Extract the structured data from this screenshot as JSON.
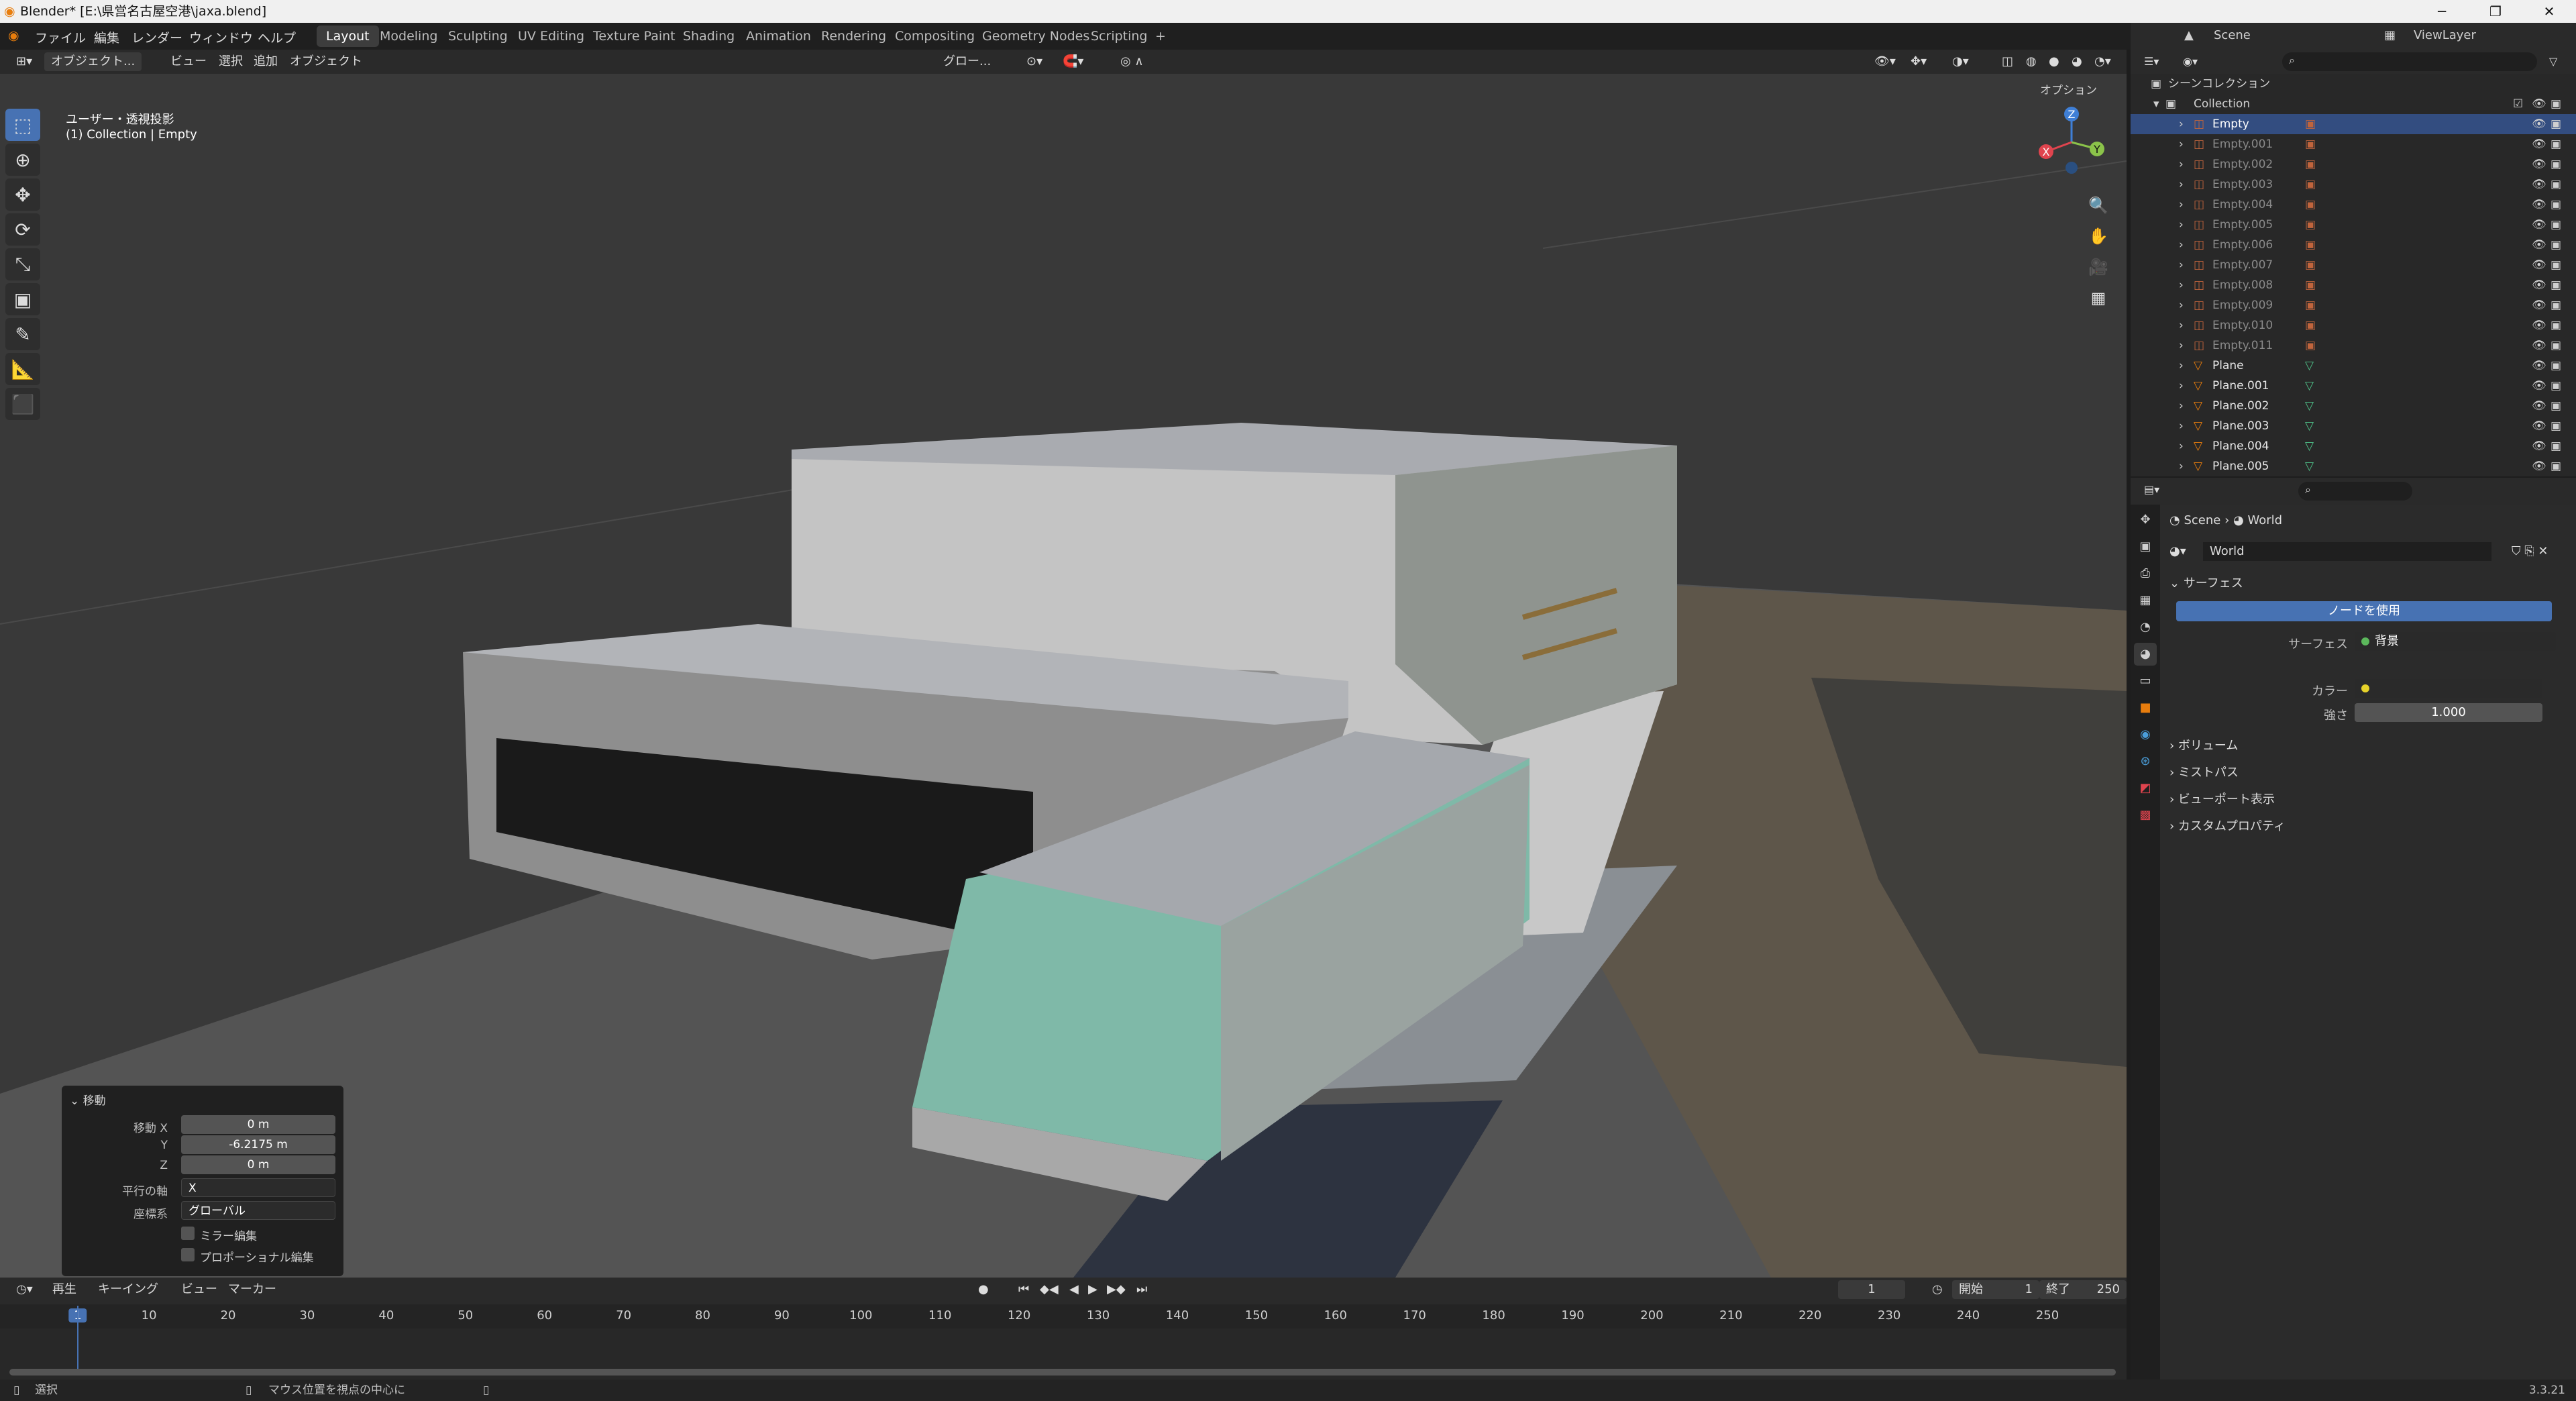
{
  "window": {
    "title": "Blender* [E:\\県営名古屋空港\\jaxa.blend]"
  },
  "menu": [
    "ファイル",
    "編集",
    "レンダー",
    "ウィンドウ",
    "ヘルプ"
  ],
  "workspaces": [
    "Layout",
    "Modeling",
    "Sculpting",
    "UV Editing",
    "Texture Paint",
    "Shading",
    "Animation",
    "Rendering",
    "Compositing",
    "Geometry Nodes",
    "Scripting"
  ],
  "workspace_add": "+",
  "scene": {
    "name": "Scene",
    "viewlayer": "ViewLayer"
  },
  "viewport": {
    "mode": "オブジェクト...",
    "menus": [
      "ビュー",
      "選択",
      "追加",
      "オブジェクト"
    ],
    "transform": "グロー...",
    "options": "オプション",
    "overlay_line1": "ユーザー・透視投影",
    "overlay_line2": "(1) Collection | Empty",
    "gizmo": {
      "x": "X",
      "y": "Y",
      "z": "Z"
    }
  },
  "operator_panel": {
    "title": "移動",
    "fields": [
      {
        "label": "移動 X",
        "value": "0 m"
      },
      {
        "label": "Y",
        "value": "-6.2175 m"
      },
      {
        "label": "Z",
        "value": "0 m"
      }
    ],
    "axis_label": "平行の軸",
    "axis_value": "X",
    "coord_label": "座標系",
    "coord_value": "グローバル",
    "check1": "ミラー編集",
    "check2": "プロポーショナル編集"
  },
  "timeline": {
    "menus": [
      "再生",
      "キーイング",
      "ビュー",
      "マーカー"
    ],
    "current_frame": "1",
    "start_label": "開始",
    "start": "1",
    "end_label": "終了",
    "end": "250",
    "ticks": [
      "1",
      "10",
      "20",
      "30",
      "40",
      "50",
      "60",
      "70",
      "80",
      "90",
      "100",
      "110",
      "120",
      "130",
      "140",
      "150",
      "160",
      "170",
      "180",
      "190",
      "200",
      "210",
      "220",
      "230",
      "240",
      "250"
    ]
  },
  "status": {
    "left": "選択",
    "middle": "マウス位置を視点の中心に",
    "version": "3.3.21"
  },
  "outliner": {
    "scene_collection": "シーンコレクション",
    "collection": "Collection",
    "items": [
      {
        "name": "Empty",
        "type": "empty",
        "selected": true
      },
      {
        "name": "Empty.001",
        "type": "empty"
      },
      {
        "name": "Empty.002",
        "type": "empty"
      },
      {
        "name": "Empty.003",
        "type": "empty"
      },
      {
        "name": "Empty.004",
        "type": "empty"
      },
      {
        "name": "Empty.005",
        "type": "empty"
      },
      {
        "name": "Empty.006",
        "type": "empty"
      },
      {
        "name": "Empty.007",
        "type": "empty"
      },
      {
        "name": "Empty.008",
        "type": "empty"
      },
      {
        "name": "Empty.009",
        "type": "empty"
      },
      {
        "name": "Empty.010",
        "type": "empty"
      },
      {
        "name": "Empty.011",
        "type": "empty"
      },
      {
        "name": "Plane",
        "type": "mesh"
      },
      {
        "name": "Plane.001",
        "type": "mesh"
      },
      {
        "name": "Plane.002",
        "type": "mesh"
      },
      {
        "name": "Plane.003",
        "type": "mesh"
      },
      {
        "name": "Plane.004",
        "type": "mesh"
      },
      {
        "name": "Plane.005",
        "type": "mesh"
      }
    ]
  },
  "properties": {
    "breadcrumb": [
      "Scene",
      "World"
    ],
    "world_name": "World",
    "surface_section": "サーフェス",
    "use_nodes": "ノードを使用",
    "surface_label": "サーフェス",
    "surface_value": "背景",
    "color_label": "カラー",
    "strength_label": "強さ",
    "strength_value": "1.000",
    "sections": [
      "ボリューム",
      "ミストパス",
      "ビューポート表示",
      "カスタムプロパティ"
    ]
  },
  "colors": {
    "accent": "#4772b3",
    "selection": "#334d80",
    "axis_x": "#e0444e",
    "axis_y": "#8bc34a",
    "axis_z": "#3f7fd6"
  }
}
